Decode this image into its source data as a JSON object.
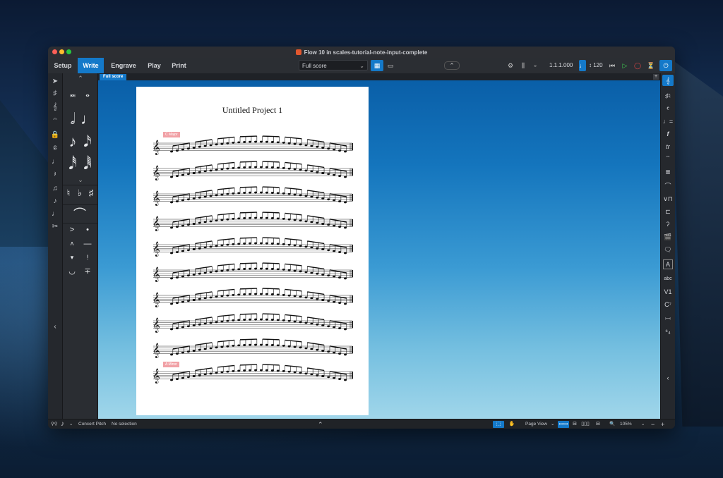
{
  "window": {
    "title": "Flow 10 in scales-tutorial-note-input-complete"
  },
  "modes": [
    {
      "label": "Setup",
      "active": false
    },
    {
      "label": "Write",
      "active": true
    },
    {
      "label": "Engrave",
      "active": false
    },
    {
      "label": "Play",
      "active": false
    },
    {
      "label": "Print",
      "active": false
    }
  ],
  "toolbar": {
    "layout_value": "Full score",
    "position": "1.1.1.000",
    "tempo": "120"
  },
  "tab": {
    "label": "Full score"
  },
  "score": {
    "title": "Untitled Project 1",
    "tags": [
      "C Major",
      "A Minor"
    ],
    "accent_tag_color": "#f1a1a6"
  },
  "status": {
    "concert_pitch": "Concert Pitch",
    "selection": "No selection",
    "view_mode": "Page View",
    "zoom": "105%"
  },
  "colors": {
    "accent": "#1479c9",
    "panel": "#2a2d32"
  }
}
